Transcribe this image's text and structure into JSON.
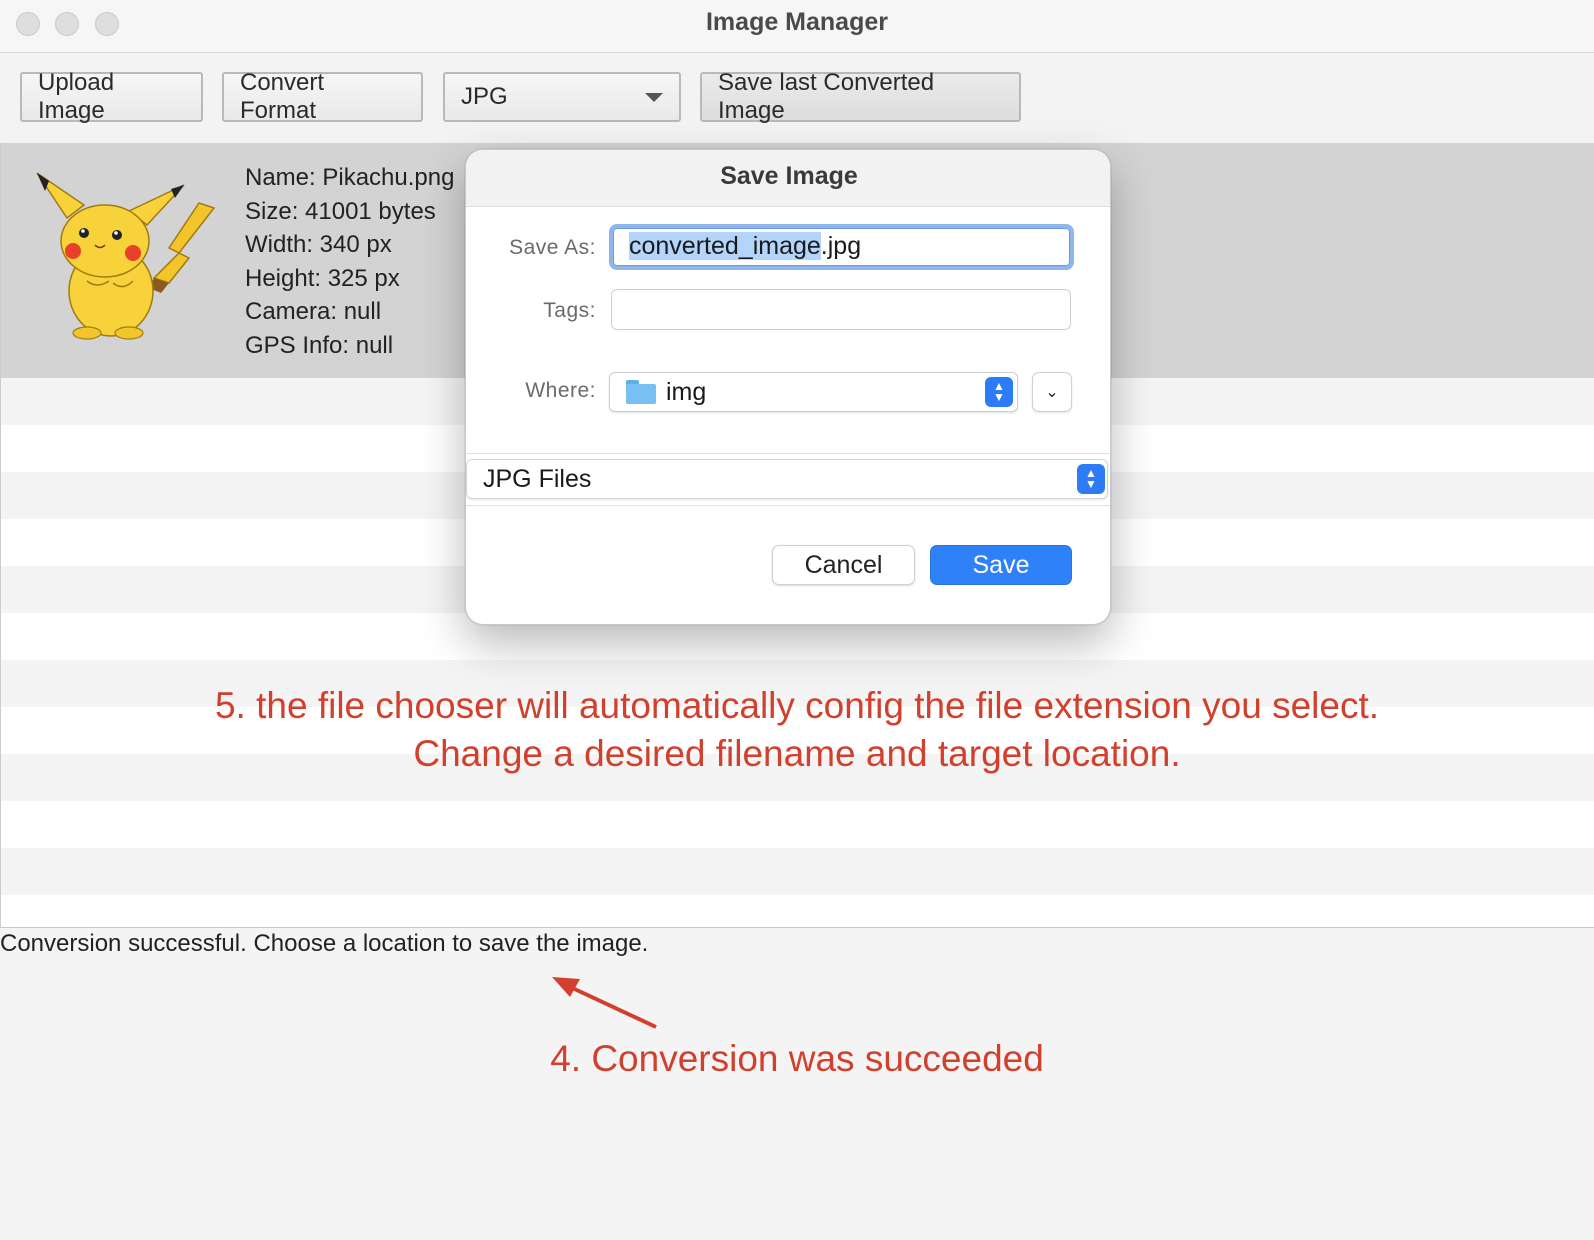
{
  "window": {
    "title": "Image Manager"
  },
  "toolbar": {
    "upload_label": "Upload Image",
    "convert_label": "Convert Format",
    "format_value": "JPG",
    "save_label": "Save last Converted Image"
  },
  "image_info": {
    "name": "Name: Pikachu.png",
    "size": "Size: 41001 bytes",
    "width": "Width: 340 px",
    "height": "Height: 325 px",
    "camera": "Camera: null",
    "gps": "GPS Info: null"
  },
  "status": {
    "text": "Conversion successful. Choose a location to save the image."
  },
  "annotations": {
    "note5_line1": "5. the file chooser will automatically config the file extension you select.",
    "note5_line2": "Change a desired filename and target location.",
    "note4": "4. Conversion was succeeded"
  },
  "dialog": {
    "title": "Save Image",
    "save_as_label": "Save As:",
    "filename_selected": "converted_image",
    "filename_ext": ".jpg",
    "tags_label": "Tags:",
    "where_label": "Where:",
    "where_value": "img",
    "file_type": "JPG Files",
    "cancel_label": "Cancel",
    "save_label": "Save"
  },
  "colors": {
    "annotation": "#d2402d",
    "accent": "#2f81f7",
    "selected_row": "#d3d3d3"
  }
}
